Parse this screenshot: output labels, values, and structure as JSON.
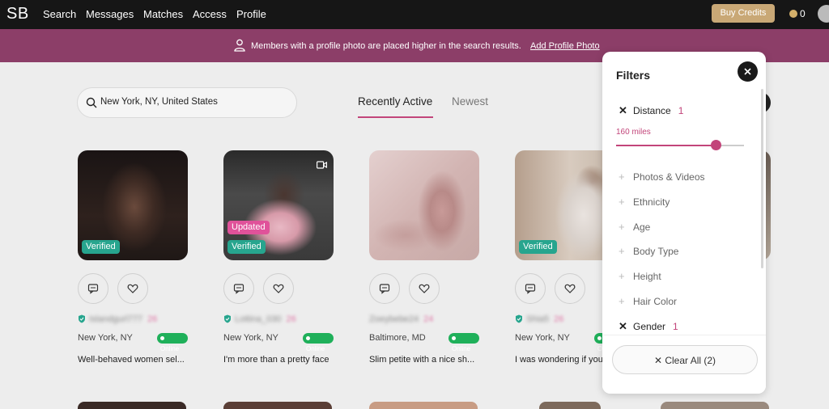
{
  "nav": {
    "logo": "SB",
    "links": [
      "Search",
      "Messages",
      "Matches",
      "Access",
      "Profile"
    ],
    "buy_credits": "Buy Credits",
    "credits": "0"
  },
  "banner": {
    "text": "Members with a profile photo are placed higher in the search results.",
    "link": "Add Profile Photo"
  },
  "search": {
    "value": "New York, NY, United States"
  },
  "tabs": {
    "active": "Recently Active",
    "other": "Newest"
  },
  "cards": [
    {
      "tags": [
        "Verified"
      ],
      "verified": true,
      "username": "Islandgurl777",
      "age": "26",
      "location": "New York, NY",
      "online": "Online",
      "bio": "Well-behaved women sel..."
    },
    {
      "tags": [
        "Updated",
        "Verified"
      ],
      "verified": true,
      "username": "Lottina_030",
      "age": "26",
      "location": "New York, NY",
      "online": "Online",
      "bio": "I'm more than a pretty face"
    },
    {
      "tags": [],
      "verified": false,
      "username": "Zoeybebe24",
      "age": "24",
      "location": "Baltimore, MD",
      "online": "Online",
      "bio": "Slim petite with a nice sh..."
    },
    {
      "tags": [
        "Verified"
      ],
      "verified": true,
      "username": "Shia5",
      "age": "26",
      "location": "New York, NY",
      "online": "Online",
      "bio": "I was wondering if you"
    }
  ],
  "filters": {
    "title": "Filters",
    "distance": {
      "label": "Distance",
      "count": "1",
      "value_text": "160 miles",
      "slider_fraction": 0.78
    },
    "items": [
      "Photos & Videos",
      "Ethnicity",
      "Age",
      "Body Type",
      "Height",
      "Hair Color"
    ],
    "gender": {
      "label": "Gender",
      "count": "1"
    },
    "clear_all": "✕ Clear All (2)"
  },
  "colors": {
    "accent": "#c2457a",
    "banner": "#8c3e68",
    "verified": "#27a58e",
    "online": "#1fb05a",
    "gold": "#c9a876"
  }
}
